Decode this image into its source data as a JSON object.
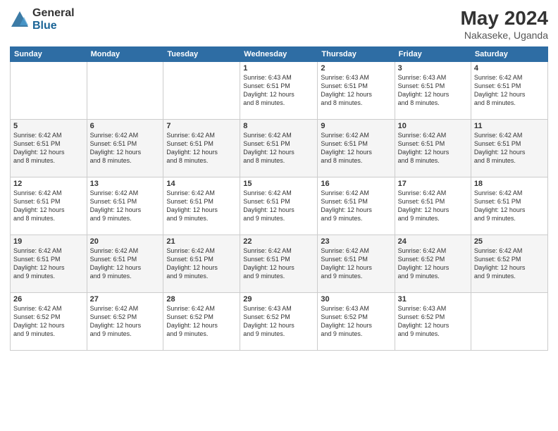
{
  "logo": {
    "general": "General",
    "blue": "Blue"
  },
  "header": {
    "month": "May 2024",
    "location": "Nakaseke, Uganda"
  },
  "weekdays": [
    "Sunday",
    "Monday",
    "Tuesday",
    "Wednesday",
    "Thursday",
    "Friday",
    "Saturday"
  ],
  "weeks": [
    [
      {
        "day": "",
        "info": ""
      },
      {
        "day": "",
        "info": ""
      },
      {
        "day": "",
        "info": ""
      },
      {
        "day": "1",
        "info": "Sunrise: 6:43 AM\nSunset: 6:51 PM\nDaylight: 12 hours\nand 8 minutes."
      },
      {
        "day": "2",
        "info": "Sunrise: 6:43 AM\nSunset: 6:51 PM\nDaylight: 12 hours\nand 8 minutes."
      },
      {
        "day": "3",
        "info": "Sunrise: 6:43 AM\nSunset: 6:51 PM\nDaylight: 12 hours\nand 8 minutes."
      },
      {
        "day": "4",
        "info": "Sunrise: 6:42 AM\nSunset: 6:51 PM\nDaylight: 12 hours\nand 8 minutes."
      }
    ],
    [
      {
        "day": "5",
        "info": "Sunrise: 6:42 AM\nSunset: 6:51 PM\nDaylight: 12 hours\nand 8 minutes."
      },
      {
        "day": "6",
        "info": "Sunrise: 6:42 AM\nSunset: 6:51 PM\nDaylight: 12 hours\nand 8 minutes."
      },
      {
        "day": "7",
        "info": "Sunrise: 6:42 AM\nSunset: 6:51 PM\nDaylight: 12 hours\nand 8 minutes."
      },
      {
        "day": "8",
        "info": "Sunrise: 6:42 AM\nSunset: 6:51 PM\nDaylight: 12 hours\nand 8 minutes."
      },
      {
        "day": "9",
        "info": "Sunrise: 6:42 AM\nSunset: 6:51 PM\nDaylight: 12 hours\nand 8 minutes."
      },
      {
        "day": "10",
        "info": "Sunrise: 6:42 AM\nSunset: 6:51 PM\nDaylight: 12 hours\nand 8 minutes."
      },
      {
        "day": "11",
        "info": "Sunrise: 6:42 AM\nSunset: 6:51 PM\nDaylight: 12 hours\nand 8 minutes."
      }
    ],
    [
      {
        "day": "12",
        "info": "Sunrise: 6:42 AM\nSunset: 6:51 PM\nDaylight: 12 hours\nand 8 minutes."
      },
      {
        "day": "13",
        "info": "Sunrise: 6:42 AM\nSunset: 6:51 PM\nDaylight: 12 hours\nand 9 minutes."
      },
      {
        "day": "14",
        "info": "Sunrise: 6:42 AM\nSunset: 6:51 PM\nDaylight: 12 hours\nand 9 minutes."
      },
      {
        "day": "15",
        "info": "Sunrise: 6:42 AM\nSunset: 6:51 PM\nDaylight: 12 hours\nand 9 minutes."
      },
      {
        "day": "16",
        "info": "Sunrise: 6:42 AM\nSunset: 6:51 PM\nDaylight: 12 hours\nand 9 minutes."
      },
      {
        "day": "17",
        "info": "Sunrise: 6:42 AM\nSunset: 6:51 PM\nDaylight: 12 hours\nand 9 minutes."
      },
      {
        "day": "18",
        "info": "Sunrise: 6:42 AM\nSunset: 6:51 PM\nDaylight: 12 hours\nand 9 minutes."
      }
    ],
    [
      {
        "day": "19",
        "info": "Sunrise: 6:42 AM\nSunset: 6:51 PM\nDaylight: 12 hours\nand 9 minutes."
      },
      {
        "day": "20",
        "info": "Sunrise: 6:42 AM\nSunset: 6:51 PM\nDaylight: 12 hours\nand 9 minutes."
      },
      {
        "day": "21",
        "info": "Sunrise: 6:42 AM\nSunset: 6:51 PM\nDaylight: 12 hours\nand 9 minutes."
      },
      {
        "day": "22",
        "info": "Sunrise: 6:42 AM\nSunset: 6:51 PM\nDaylight: 12 hours\nand 9 minutes."
      },
      {
        "day": "23",
        "info": "Sunrise: 6:42 AM\nSunset: 6:51 PM\nDaylight: 12 hours\nand 9 minutes."
      },
      {
        "day": "24",
        "info": "Sunrise: 6:42 AM\nSunset: 6:52 PM\nDaylight: 12 hours\nand 9 minutes."
      },
      {
        "day": "25",
        "info": "Sunrise: 6:42 AM\nSunset: 6:52 PM\nDaylight: 12 hours\nand 9 minutes."
      }
    ],
    [
      {
        "day": "26",
        "info": "Sunrise: 6:42 AM\nSunset: 6:52 PM\nDaylight: 12 hours\nand 9 minutes."
      },
      {
        "day": "27",
        "info": "Sunrise: 6:42 AM\nSunset: 6:52 PM\nDaylight: 12 hours\nand 9 minutes."
      },
      {
        "day": "28",
        "info": "Sunrise: 6:42 AM\nSunset: 6:52 PM\nDaylight: 12 hours\nand 9 minutes."
      },
      {
        "day": "29",
        "info": "Sunrise: 6:43 AM\nSunset: 6:52 PM\nDaylight: 12 hours\nand 9 minutes."
      },
      {
        "day": "30",
        "info": "Sunrise: 6:43 AM\nSunset: 6:52 PM\nDaylight: 12 hours\nand 9 minutes."
      },
      {
        "day": "31",
        "info": "Sunrise: 6:43 AM\nSunset: 6:52 PM\nDaylight: 12 hours\nand 9 minutes."
      },
      {
        "day": "",
        "info": ""
      }
    ]
  ]
}
